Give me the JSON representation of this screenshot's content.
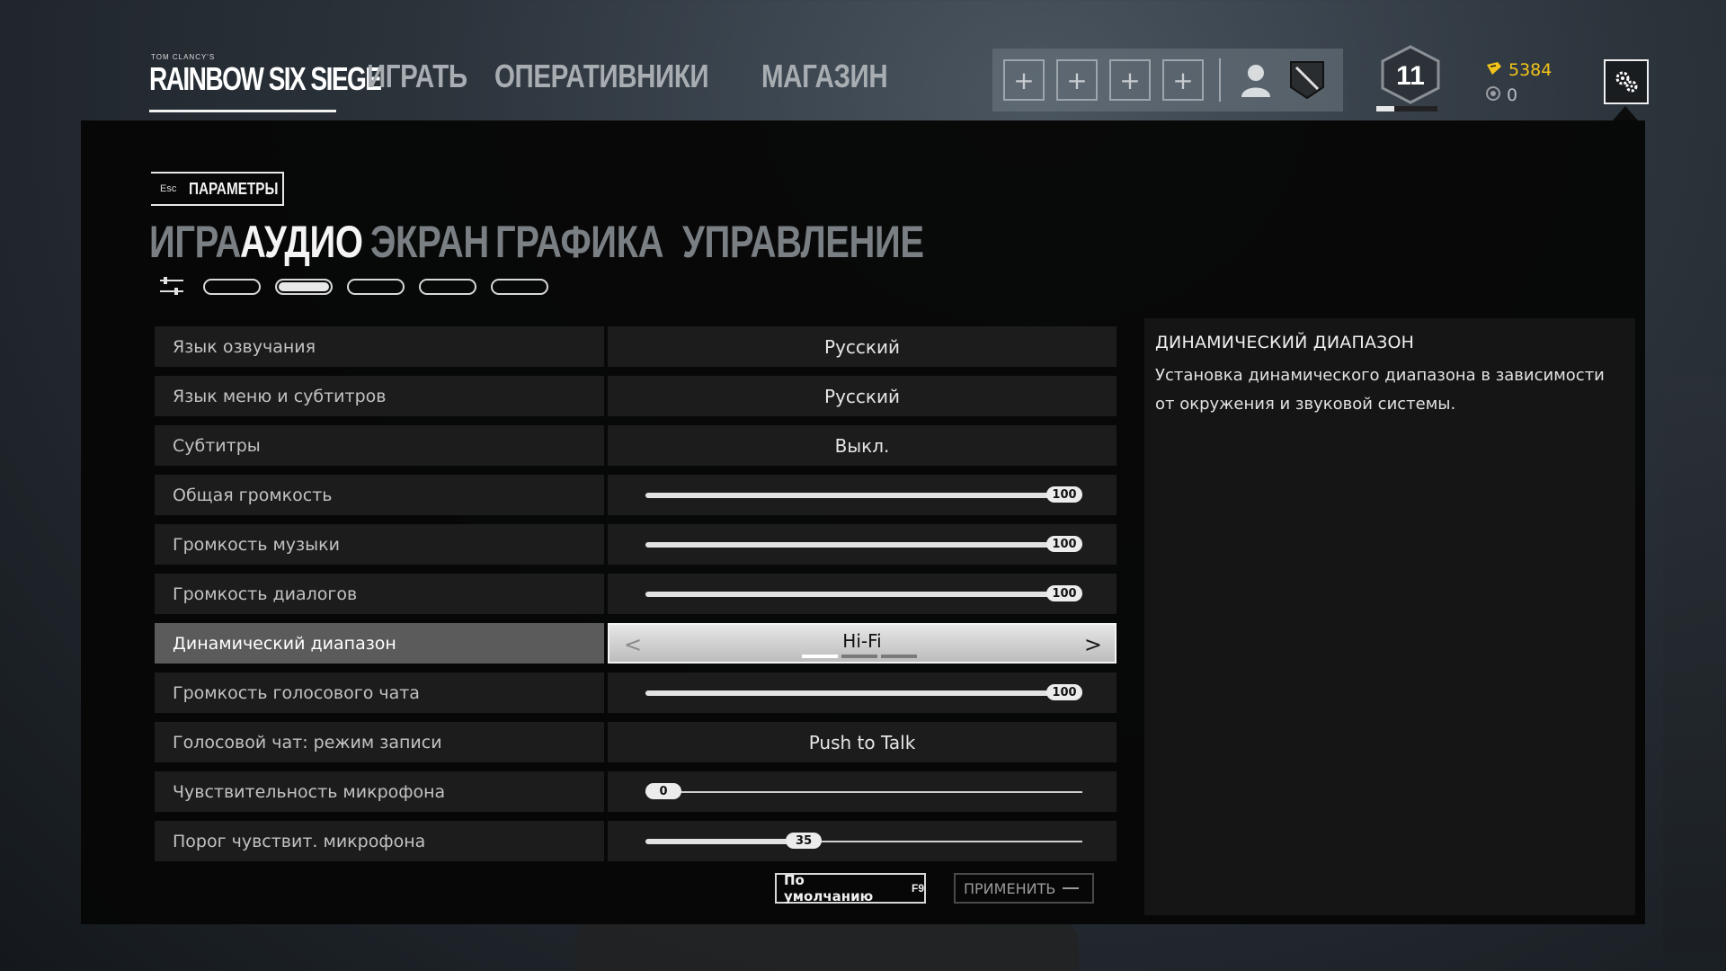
{
  "header": {
    "logo_small": "TOM CLANCY'S",
    "logo_text": "RAINBOW SIX SIEGE",
    "nav": [
      "ИГРАТЬ",
      "ОПЕРАТИВНИКИ",
      "МАГАЗИН"
    ],
    "squad_slots": [
      "+",
      "+",
      "+",
      "+"
    ],
    "rank_level": "11",
    "rank_progress": 0.3,
    "renown": "5384",
    "credits": "0",
    "renown_color": "#f2c31b"
  },
  "settings_page": {
    "back_key": "Esc",
    "back_label": "ПАРАМЕТРЫ",
    "tabs": [
      "ИГРА",
      "АУДИО",
      "ЭКРАН",
      "ГРАФИКА",
      "УПРАВЛЕНИЕ"
    ],
    "active_tab": "АУДИО",
    "active_subtab_index": 1
  },
  "rows": {
    "voice_lang": {
      "label": "Язык озвучания",
      "value": "Русский"
    },
    "menu_lang": {
      "label": "Язык меню и субтитров",
      "value": "Русский"
    },
    "subtitles": {
      "label": "Субтитры",
      "value": "Выкл."
    },
    "master_volume": {
      "label": "Общая громкость",
      "value": "100"
    },
    "music_volume": {
      "label": "Громкость музыки",
      "value": "100"
    },
    "dialog_volume": {
      "label": "Громкость диалогов",
      "value": "100"
    },
    "dynamic_range": {
      "label": "Динамический диапазон",
      "value": "Hi-Fi",
      "options_total": 3,
      "selected_index": 0
    },
    "voice_chat_volume": {
      "label": "Громкость голосового чата",
      "value": "100"
    },
    "voice_chat_mode": {
      "label": "Голосовой чат: режим записи",
      "value": "Push to Talk"
    },
    "mic_sensitivity": {
      "label": "Чувствительность микрофона",
      "value": "0"
    },
    "mic_threshold": {
      "label": "Порог чувствит. микрофона",
      "value": "35"
    }
  },
  "buttons": {
    "default_label": "По умолчанию",
    "default_key": "F9",
    "apply_label": "ПРИМЕНИТЬ"
  },
  "description": {
    "title": "ДИНАМИЧЕСКИЙ ДИАПАЗОН",
    "text": "Установка динамического диапазона в зависимости от окружения и звуковой системы."
  }
}
